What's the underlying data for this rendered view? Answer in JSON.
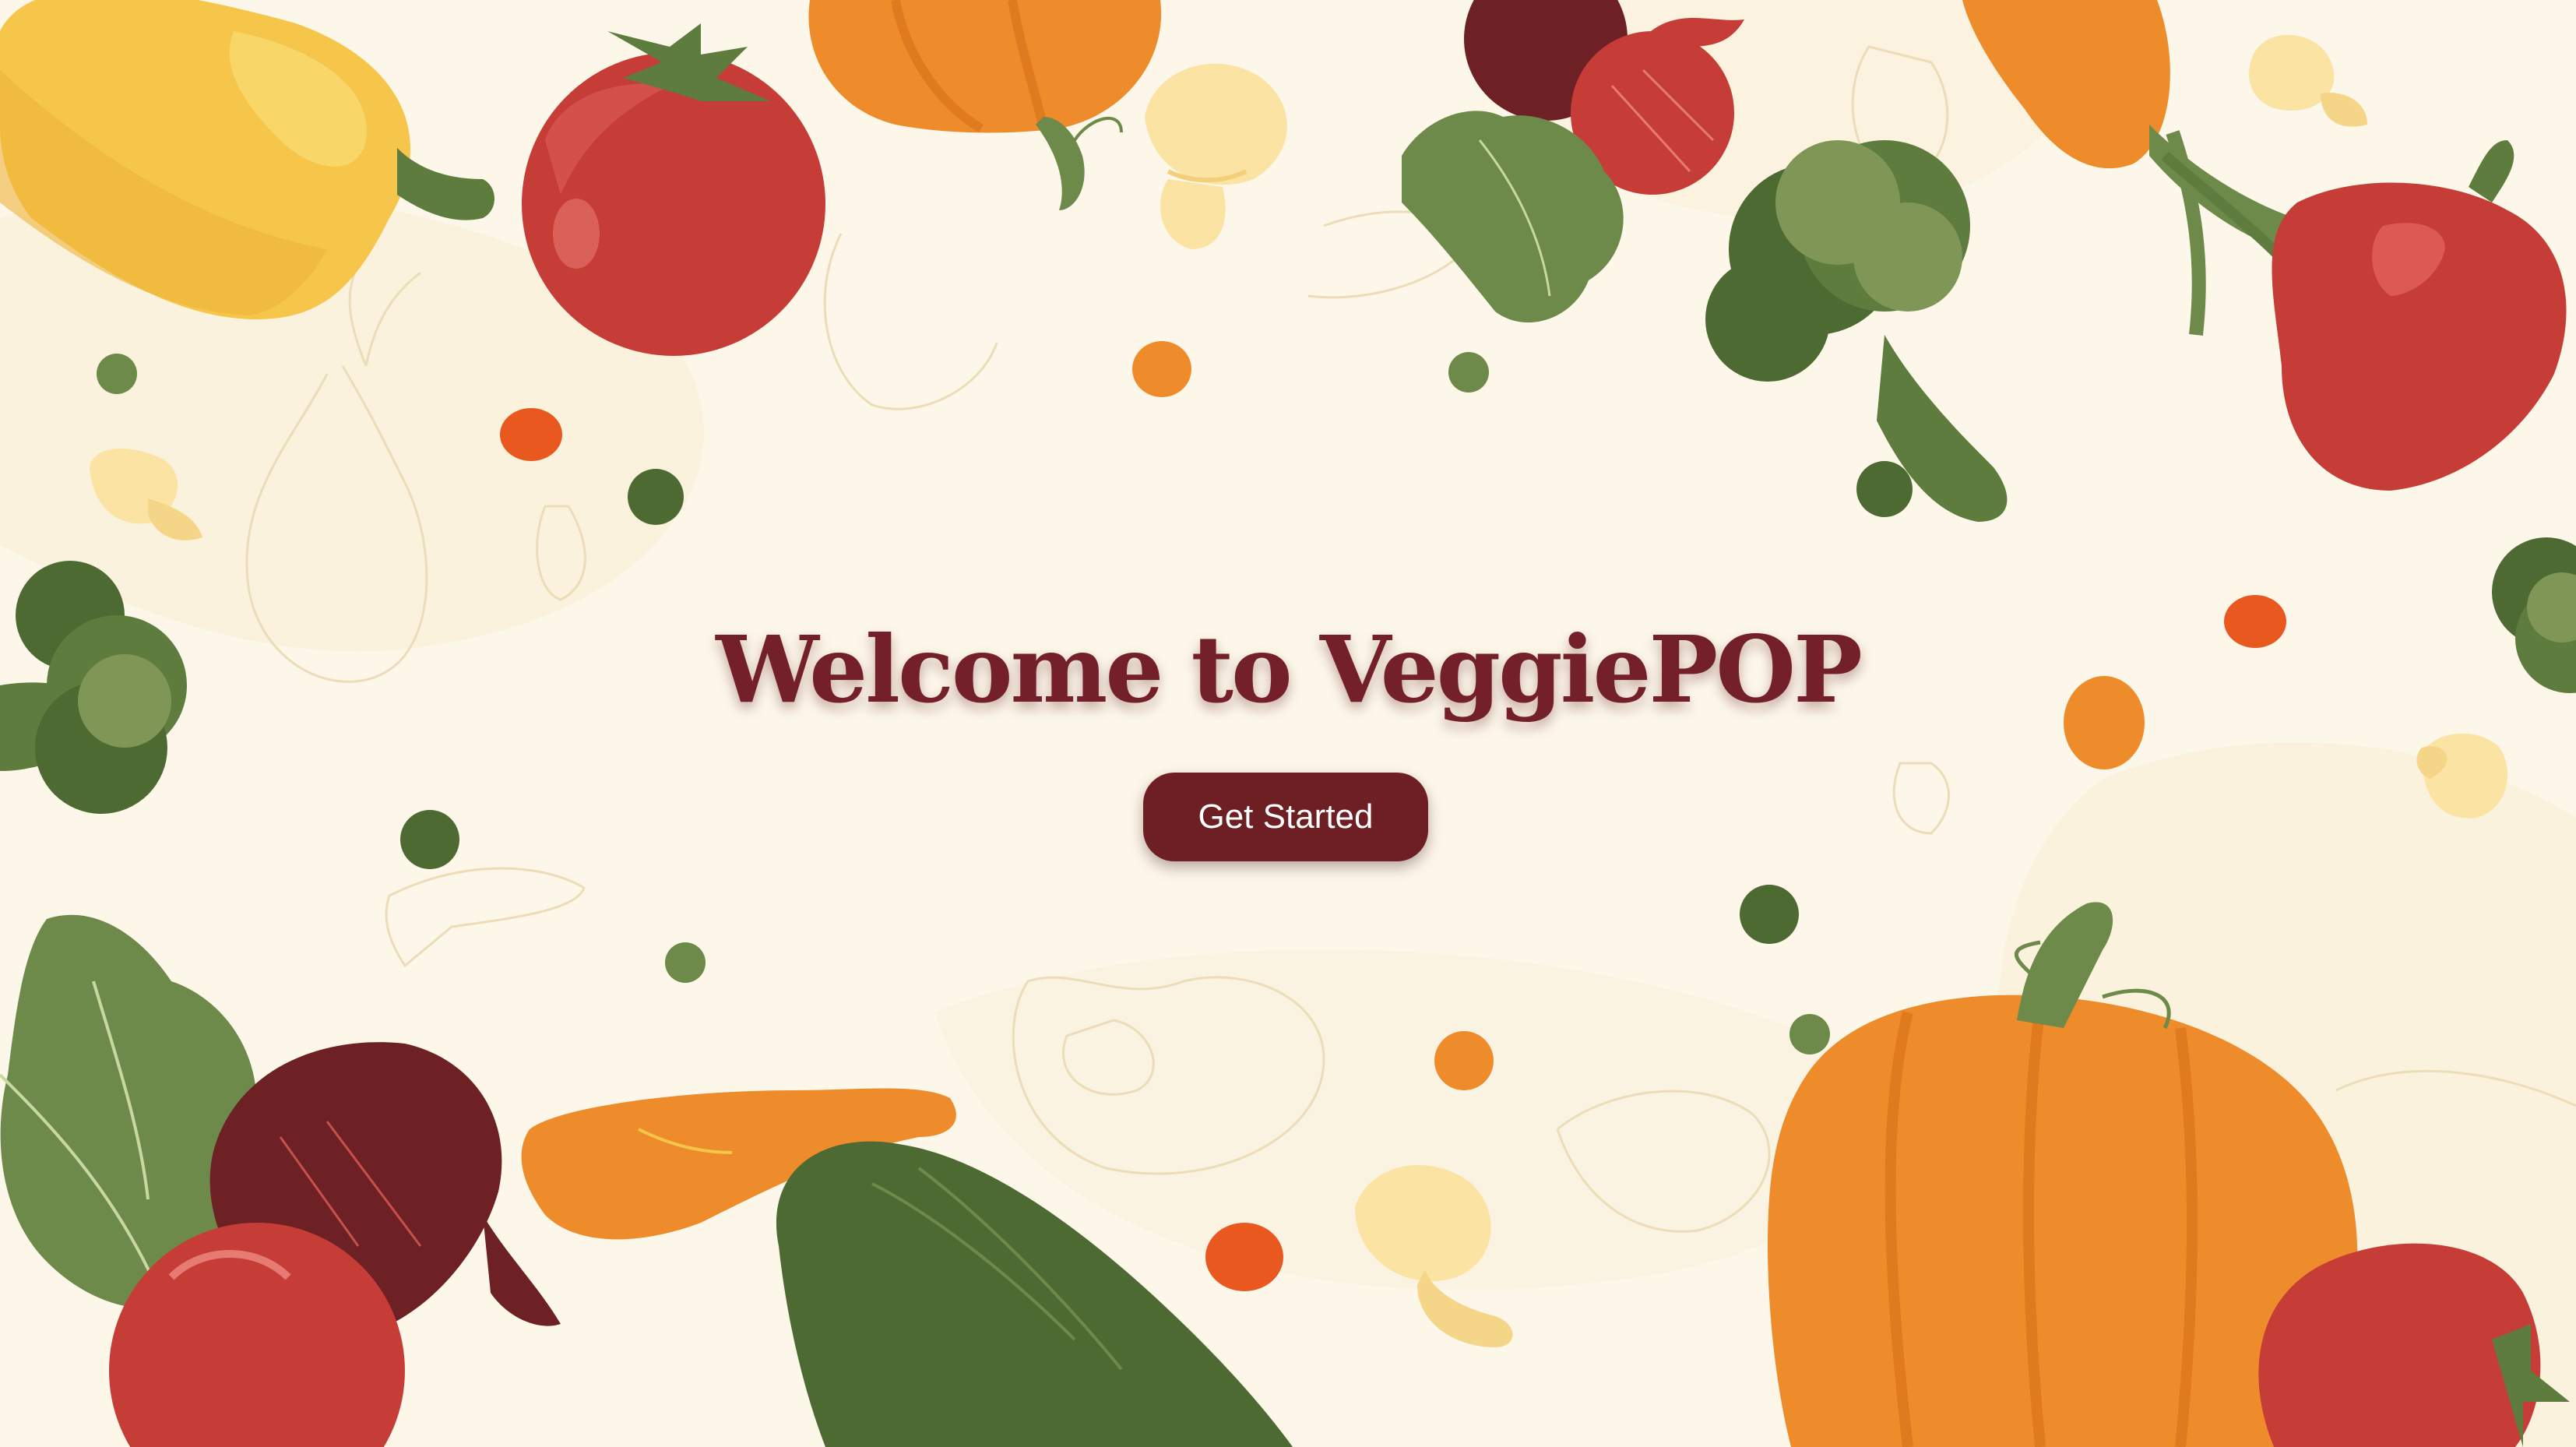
{
  "hero": {
    "title": "Welcome to VeggiePOP",
    "cta_label": "Get Started"
  },
  "colors": {
    "background": "#fdf7ea",
    "title": "#74202a",
    "button": "#6e1f24",
    "button_text": "#ffffff"
  },
  "illustrations": [
    "bell-pepper-icon",
    "tomato-icon",
    "pumpkin-icon",
    "mushroom-icon",
    "beet-icon",
    "carrot-icon",
    "broccoli-icon",
    "red-pepper-icon",
    "cucumber-icon",
    "lettuce-icon",
    "pea-icon"
  ]
}
